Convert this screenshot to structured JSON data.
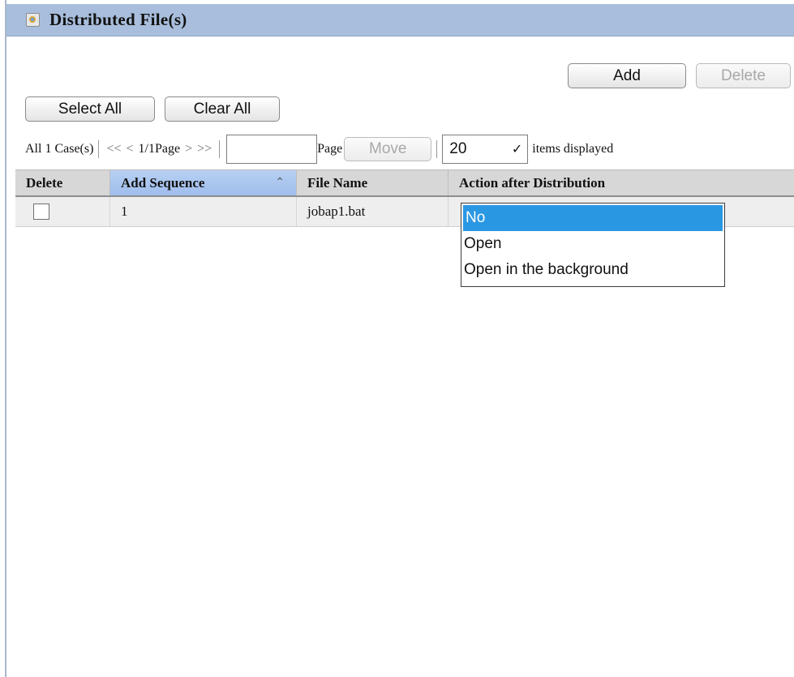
{
  "panel": {
    "title": "Distributed File(s)"
  },
  "toolbar": {
    "add_label": "Add",
    "delete_label": "Delete",
    "select_all_label": "Select All",
    "clear_all_label": "Clear All"
  },
  "pager": {
    "total_text": "All 1 Case(s)",
    "first": "<<",
    "prev": "<",
    "page_info": "1/1Page",
    "next": ">",
    "last": ">>",
    "page_input_value": "",
    "page_label": "Page",
    "move_label": "Move",
    "items_per_page": "20",
    "items_label": "items displayed"
  },
  "table": {
    "columns": [
      "Delete",
      "Add Sequence",
      "File Name",
      "Action after Distribution"
    ],
    "sorted_column": "Add Sequence",
    "rows": [
      {
        "sequence": "1",
        "file_name": "jobap1.bat",
        "action": "No",
        "checked": false
      }
    ]
  },
  "action_dropdown": {
    "options": [
      "No",
      "Open",
      "Open in the background"
    ],
    "selected": "No"
  },
  "colors": {
    "title_bar": "#a8bedc",
    "sorted_header": "#a9c6f0",
    "selected_option": "#2a97e3"
  }
}
